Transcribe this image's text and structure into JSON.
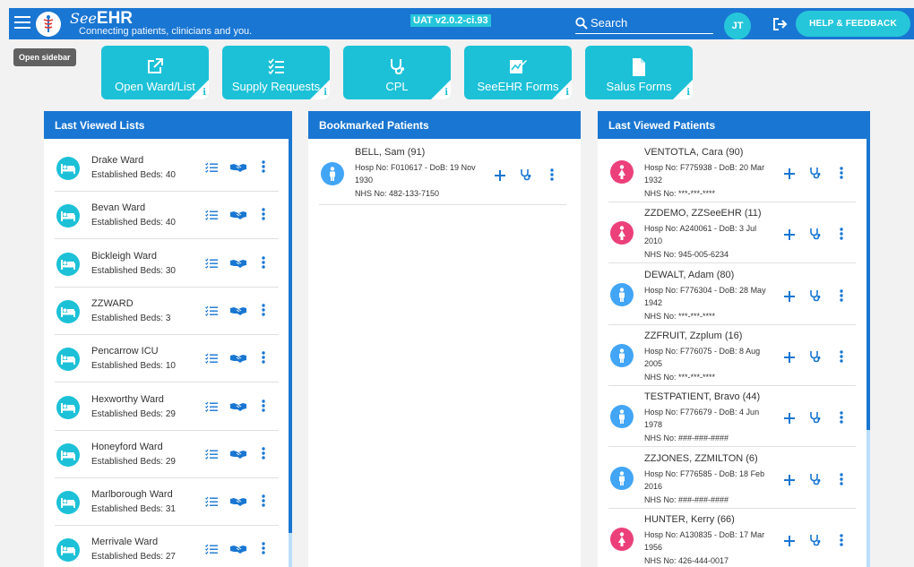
{
  "header": {
    "brand_see": "See",
    "brand_ehr": "EHR",
    "tagline": "Connecting patients, clinicians and you.",
    "version": "UAT v2.0.2-ci.93",
    "search_placeholder": "Search",
    "user_initials": "JT",
    "help_label": "HELP & FEEDBACK"
  },
  "tooltip": "Open sidebar",
  "tiles": [
    {
      "label": "Open Ward/List",
      "icon": "external-link-icon"
    },
    {
      "label": "Supply Requests",
      "icon": "checklist-icon"
    },
    {
      "label": "CPL",
      "icon": "stethoscope-icon"
    },
    {
      "label": "SeeEHR Forms",
      "icon": "form-edit-icon"
    },
    {
      "label": "Salus Forms",
      "icon": "document-icon"
    }
  ],
  "tile_info": "i",
  "panels": {
    "last_viewed_lists": "Last Viewed Lists",
    "bookmarked_patients": "Bookmarked Patients",
    "last_viewed_patients": "Last Viewed Patients"
  },
  "wards": [
    {
      "name": "Drake Ward",
      "beds": "Established Beds: 40"
    },
    {
      "name": "Bevan Ward",
      "beds": "Established Beds: 40"
    },
    {
      "name": "Bickleigh Ward",
      "beds": "Established Beds: 30"
    },
    {
      "name": "ZZWARD",
      "beds": "Established Beds: 3"
    },
    {
      "name": "Pencarrow ICU",
      "beds": "Established Beds: 10"
    },
    {
      "name": "Hexworthy Ward",
      "beds": "Established Beds: 29"
    },
    {
      "name": "Honeyford Ward",
      "beds": "Established Beds: 29"
    },
    {
      "name": "Marlborough Ward",
      "beds": "Established Beds: 31"
    },
    {
      "name": "Merrivale Ward",
      "beds": "Established Beds: 27"
    }
  ],
  "bookmarked": [
    {
      "name": "BELL, Sam (91)",
      "hosp1": "Hosp No: F010617 - DoB: 19 Nov",
      "hosp2": "1930",
      "nhs": "NHS No: 482-133-7150",
      "sex": "male"
    }
  ],
  "recent_patients": [
    {
      "name": "VENTOTLA, Cara (90)",
      "hosp1": "Hosp No: F775938 - DoB: 20 Mar",
      "hosp2": "1932",
      "nhs": "NHS No: ***-***-****",
      "sex": "female"
    },
    {
      "name": "ZZDEMO, ZZSeeEHR (11)",
      "hosp1": "Hosp No: A240061 - DoB: 3 Jul",
      "hosp2": "2010",
      "nhs": "NHS No: 945-005-6234",
      "sex": "female"
    },
    {
      "name": "DEWALT, Adam (80)",
      "hosp1": "Hosp No: F776304 - DoB: 28 May",
      "hosp2": "1942",
      "nhs": "NHS No: ***-***-****",
      "sex": "male"
    },
    {
      "name": "ZZFRUIT, Zzplum (16)",
      "hosp1": "Hosp No: F776075 - DoB: 8 Aug",
      "hosp2": "2005",
      "nhs": "NHS No: ***-***-****",
      "sex": "male"
    },
    {
      "name": "TESTPATIENT, Bravo (44)",
      "hosp1": "Hosp No: F776679 - DoB: 4 Jun",
      "hosp2": "1978",
      "nhs": "NHS No: ###-###-####",
      "sex": "male"
    },
    {
      "name": "ZZJONES, ZZMILTON (6)",
      "hosp1": "Hosp No: F776585 - DoB: 18 Feb",
      "hosp2": "2016",
      "nhs": "NHS No: ###-###-####",
      "sex": "male"
    },
    {
      "name": "HUNTER, Kerry (66)",
      "hosp1": "Hosp No: A130835 - DoB: 17 Mar",
      "hosp2": "1956",
      "nhs": "NHS No: 426-444-0017",
      "sex": "female"
    }
  ],
  "colors": {
    "primary": "#1976d2",
    "accent": "#1cc1d7",
    "male": "#42a5f5",
    "female": "#ec407a"
  }
}
